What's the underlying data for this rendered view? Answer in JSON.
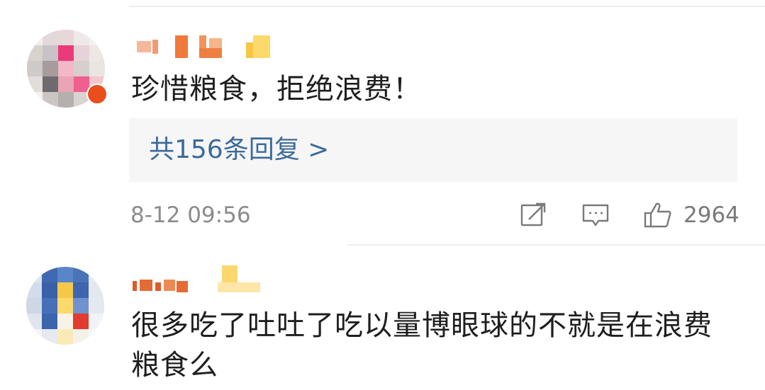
{
  "comments": [
    {
      "text": "珍惜粮食，拒绝浪费！",
      "reply_link": "共156条回复 >",
      "timestamp": "8-12 09:56",
      "like_count": "2964"
    },
    {
      "text": "很多吃了吐吐了吃以量博眼球的不就是在浪费粮食么"
    }
  ],
  "icons": {
    "share": "share-icon",
    "comment": "comment-icon",
    "like": "like-icon"
  },
  "colors": {
    "link": "#3c6a9b",
    "meta": "#8b8b8b",
    "reply_bg": "#f6f6f7"
  }
}
